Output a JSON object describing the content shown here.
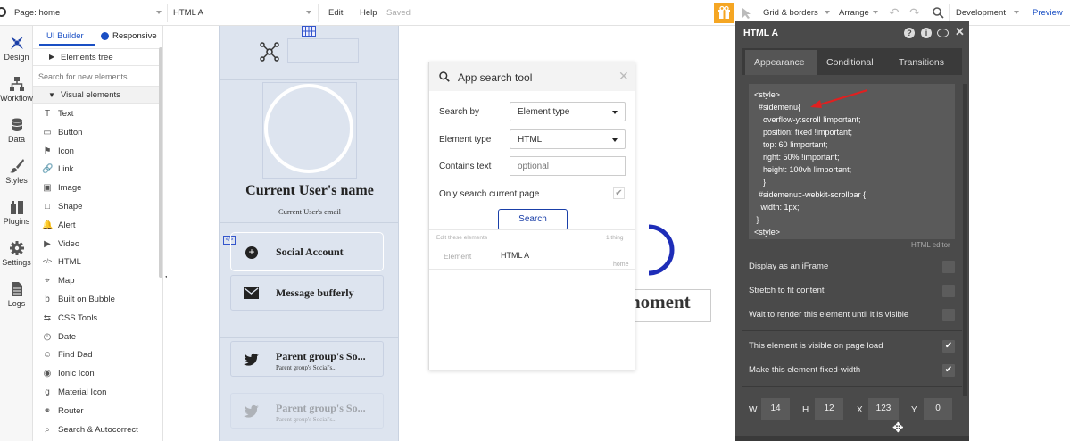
{
  "topbar": {
    "page_label": "Page: home",
    "element_label": "HTML A",
    "edit": "Edit",
    "help": "Help",
    "saved": "Saved",
    "grid_borders": "Grid & borders",
    "arrange": "Arrange",
    "development": "Development",
    "preview": "Preview"
  },
  "iconbar": {
    "items": [
      {
        "label": "Design"
      },
      {
        "label": "Workflow"
      },
      {
        "label": "Data"
      },
      {
        "label": "Styles"
      },
      {
        "label": "Plugins"
      },
      {
        "label": "Settings"
      },
      {
        "label": "Logs"
      }
    ]
  },
  "elements_panel": {
    "tab_ui_builder": "UI Builder",
    "tab_responsive": "Responsive",
    "elements_tree": "Elements tree",
    "search_placeholder": "Search for new elements...",
    "visual_elements": "Visual elements",
    "items": [
      {
        "label": "Text",
        "icon": "T"
      },
      {
        "label": "Button",
        "icon": "▭"
      },
      {
        "label": "Icon",
        "icon": "⚑"
      },
      {
        "label": "Link",
        "icon": "🔗"
      },
      {
        "label": "Image",
        "icon": "▣"
      },
      {
        "label": "Shape",
        "icon": "□"
      },
      {
        "label": "Alert",
        "icon": "🔔"
      },
      {
        "label": "Video",
        "icon": "▶"
      },
      {
        "label": "HTML",
        "icon": "</>"
      },
      {
        "label": "Map",
        "icon": "⌖"
      },
      {
        "label": "Built on Bubble",
        "icon": "b"
      },
      {
        "label": "CSS Tools",
        "icon": "⇆"
      },
      {
        "label": "Date",
        "icon": "◷"
      },
      {
        "label": "Find Dad",
        "icon": "☺"
      },
      {
        "label": "Ionic Icon",
        "icon": "◉"
      },
      {
        "label": "Material Icon",
        "icon": "g"
      },
      {
        "label": "Router",
        "icon": "⚭"
      },
      {
        "label": "Search & Autocorrect",
        "icon": "⌕"
      }
    ]
  },
  "canvas": {
    "user_name": "Current User's name",
    "user_email": "Current User's email",
    "social_account": "Social Account",
    "message": "Message bufferly",
    "parent_1": "Parent group's So...",
    "parent_1_sub": "Parent group's Social's...",
    "parent_2": "Parent group's So...",
    "parent_2_sub": "Parent group's Social's...",
    "moment_text": "noment"
  },
  "search_tool": {
    "title": "App search tool",
    "search_by_label": "Search by",
    "search_by_value": "Element type",
    "element_type_label": "Element type",
    "element_type_value": "HTML",
    "contains_text_label": "Contains text",
    "contains_text_placeholder": "optional",
    "only_current_label": "Only search current page",
    "search_button": "Search",
    "edit_these": "Edit these elements",
    "count": "1 thing",
    "result_col": "Element",
    "result_value": "HTML A",
    "result_page": "home"
  },
  "property_editor": {
    "title": "HTML A",
    "tabs": [
      "Appearance",
      "Conditional",
      "Transitions"
    ],
    "code_lines": [
      "<style>",
      "  #sidemenu{",
      "    overflow-y:scroll !important;",
      "    position: fixed !important;",
      "    top: 60 !important;",
      "    right: 50% !important;",
      "    height: 100vh !important;",
      "    }",
      "  #sidemenu::-webkit-scrollbar {",
      "   width: 1px;",
      " }",
      "<style>"
    ],
    "html_editor": "HTML editor",
    "display_iframe": "Display as an iFrame",
    "stretch": "Stretch to fit content",
    "wait_render": "Wait to render this element until it is visible",
    "visible_on_load": "This element is visible on page load",
    "fixed_width": "Make this element fixed-width",
    "w_label": "W",
    "w_value": "14",
    "h_label": "H",
    "h_value": "12",
    "x_label": "X",
    "x_value": "123",
    "y_label": "Y",
    "y_value": "0"
  },
  "colors": {
    "accent_blue": "#1a4fc4",
    "panel_dark": "#4a4a4a",
    "page_bg": "#dde4ef",
    "gift_orange": "#f5a623",
    "arrow_red": "#e02020"
  }
}
